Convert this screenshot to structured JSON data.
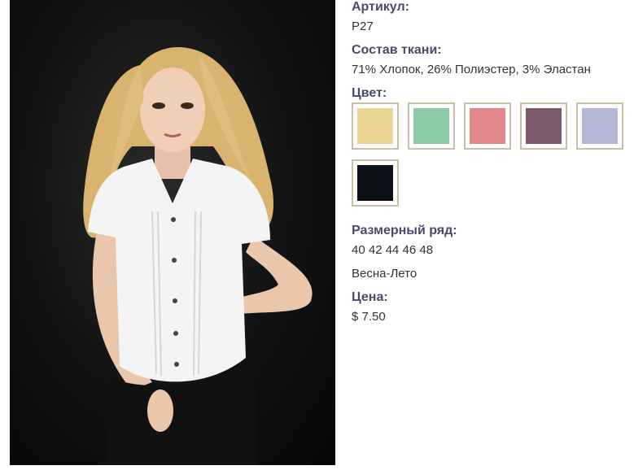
{
  "product": {
    "article_label": "Артикул:",
    "article_value": "P27",
    "fabric_label": "Состав ткани:",
    "fabric_value": "71% Хлопок, 26% Полиэстер, 3% Эластан",
    "color_label": "Цвет:",
    "colors": [
      {
        "name": "yellow",
        "hex": "#ecd592"
      },
      {
        "name": "mint",
        "hex": "#8ccaa6"
      },
      {
        "name": "coral",
        "hex": "#e2888c"
      },
      {
        "name": "mauve",
        "hex": "#7a5a6c"
      },
      {
        "name": "lavender",
        "hex": "#b3b8d8"
      },
      {
        "name": "black",
        "hex": "#0e1018"
      }
    ],
    "size_label": "Размерный ряд:",
    "size_value": "40 42 44 46 48",
    "season_value": "Весна-Лето",
    "price_label": "Цена:",
    "price_value": "$ 7.50"
  },
  "image": {
    "background": "#0c0c0c",
    "shirt_color": "#f4f4f4",
    "hair_color": "#d9b46e",
    "pants_color": "#111111"
  }
}
